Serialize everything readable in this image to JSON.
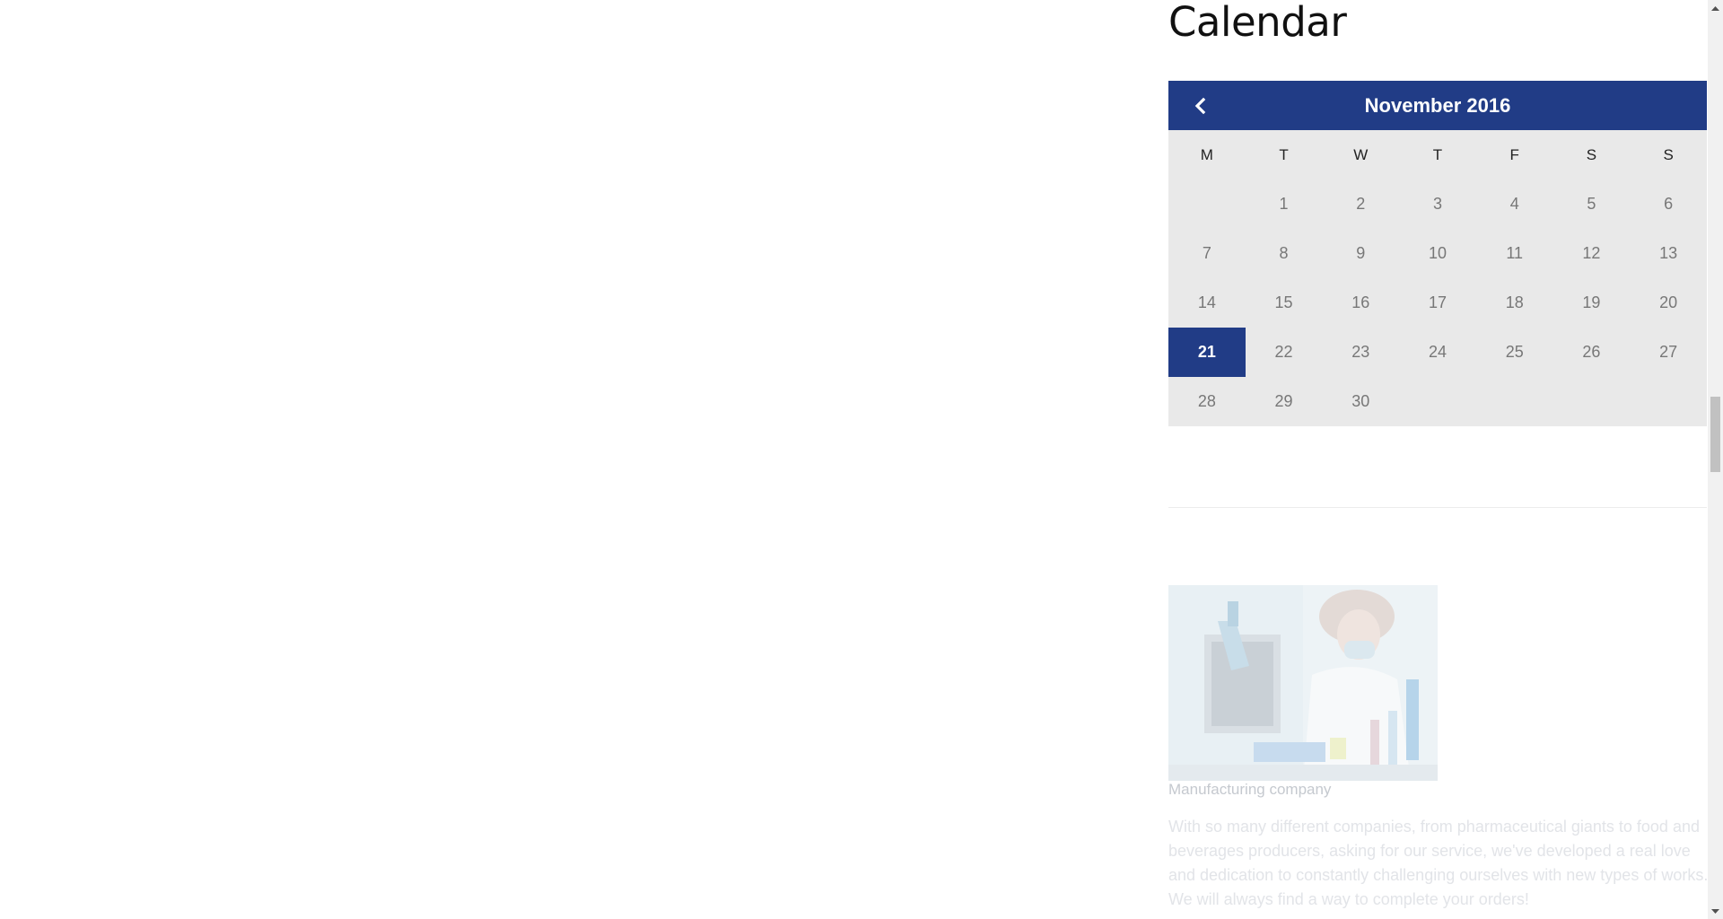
{
  "widget": {
    "title": "Calendar"
  },
  "calendar": {
    "month_label": "November 2016",
    "prev_icon": "chevron-left-icon",
    "weekdays": [
      "M",
      "T",
      "W",
      "T",
      "F",
      "S",
      "S"
    ],
    "days": [
      "",
      "1",
      "2",
      "3",
      "4",
      "5",
      "6",
      "7",
      "8",
      "9",
      "10",
      "11",
      "12",
      "13",
      "14",
      "15",
      "16",
      "17",
      "18",
      "19",
      "20",
      "21",
      "22",
      "23",
      "24",
      "25",
      "26",
      "27",
      "28",
      "29",
      "30",
      "",
      "",
      "",
      ""
    ],
    "today": "21",
    "accent_color": "#213c86"
  },
  "post": {
    "title": "Manufacturing company",
    "excerpt": "With so many different companies, from pharmaceutical giants to food and beverages producers, asking for our service, we've developed a real love and dedication to constantly challenging ourselves with new types of works. We will always find a way to complete your orders!"
  },
  "scrollbar": {
    "up_icon": "scroll-up-arrow-icon",
    "down_icon": "scroll-down-arrow-icon"
  }
}
